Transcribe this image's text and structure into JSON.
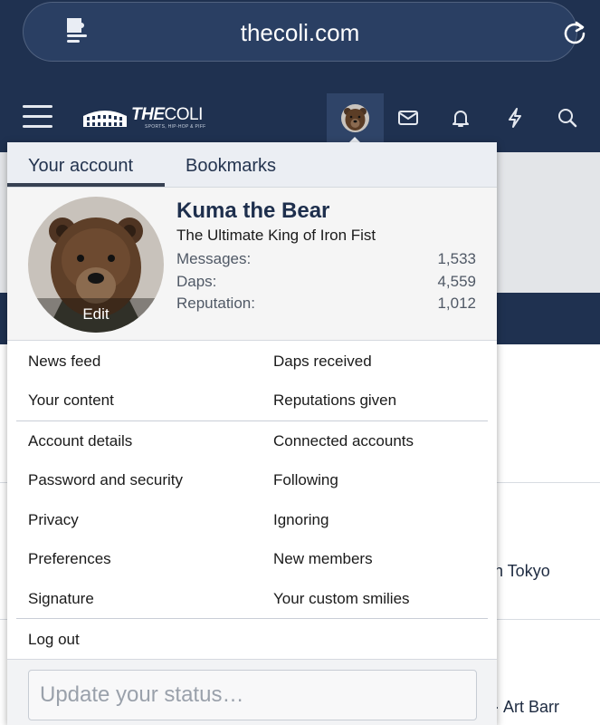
{
  "browser": {
    "url": "thecoli.com",
    "extension_icon": "puzzle-doc-icon",
    "reload_icon": "reload-icon"
  },
  "header": {
    "logo_text_bold": "THE",
    "logo_text_thin": "COLI",
    "logo_tagline": "SPORTS, HIP-HOP & PIFF",
    "icons": [
      "menu-icon",
      "avatar",
      "mail-icon",
      "bell-icon",
      "lightning-icon",
      "search-icon"
    ]
  },
  "background": {
    "text_1": "n Tokyo",
    "text_2": "· Art Barr"
  },
  "menu": {
    "tabs": [
      {
        "label": "Your account",
        "active": true
      },
      {
        "label": "Bookmarks",
        "active": false
      }
    ],
    "account": {
      "username": "Kuma the Bear",
      "user_title": "The Ultimate King of Iron Fist",
      "avatar_edit_label": "Edit",
      "stats": [
        {
          "label": "Messages:",
          "value": "1,533"
        },
        {
          "label": "Daps:",
          "value": "4,559"
        },
        {
          "label": "Reputation:",
          "value": "1,012"
        }
      ]
    },
    "links_group1_left": [
      "News feed",
      "Your content"
    ],
    "links_group1_right": [
      "Daps received",
      "Reputations given"
    ],
    "links_group2_left": [
      "Account details",
      "Password and security",
      "Privacy",
      "Preferences",
      "Signature"
    ],
    "links_group2_right": [
      "Connected accounts",
      "Following",
      "Ignoring",
      "New members",
      "Your custom smilies"
    ],
    "logout_label": "Log out",
    "status_placeholder": "Update your status…"
  },
  "colors": {
    "header_bg": "#1f3150",
    "tab_bg": "#ebeef3",
    "username": "#1e2f4d"
  }
}
